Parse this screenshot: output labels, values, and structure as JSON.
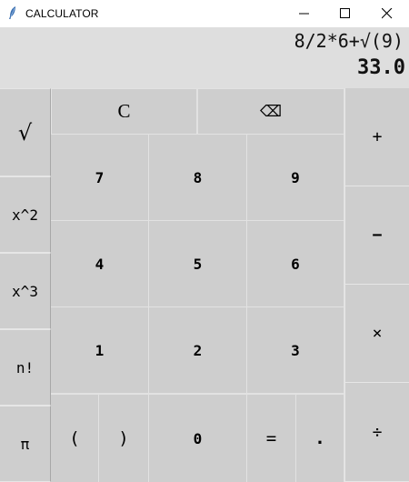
{
  "window": {
    "title": "CALCULATOR",
    "icon": "feather-icon",
    "controls": [
      "minimize-icon",
      "maximize-icon",
      "close-icon"
    ]
  },
  "display": {
    "expression": "8/2*6+√(9)",
    "result": "33.0"
  },
  "keys": {
    "sqrt": "√",
    "square": "x^2",
    "cube": "x^3",
    "factorial": "n!",
    "pi": "π",
    "clear": "C",
    "backspace": "⌫",
    "seven": "7",
    "eight": "8",
    "nine": "9",
    "four": "4",
    "five": "5",
    "six": "6",
    "one": "1",
    "two": "2",
    "three": "3",
    "open_paren": "(",
    "close_paren": ")",
    "zero": "0",
    "equals": "=",
    "dot": ".",
    "plus": "+",
    "minus": "−",
    "multiply": "×",
    "divide": "÷"
  }
}
